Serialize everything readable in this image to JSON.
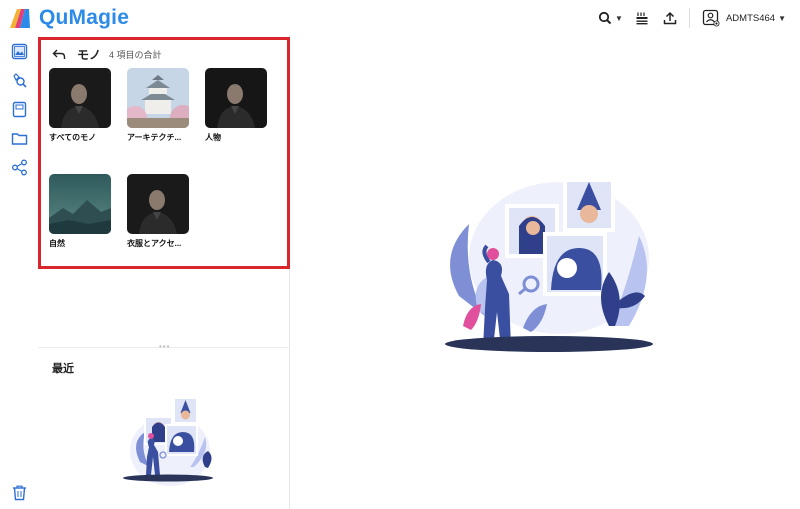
{
  "app": {
    "brand": "QuMagie"
  },
  "header": {
    "user_name": "ADMTS464",
    "icons": [
      "search-icon",
      "stream-icon",
      "upload-icon",
      "user-icon"
    ]
  },
  "rail": {
    "icons": [
      "photos-icon",
      "ai-search-icon",
      "album-icon",
      "folder-icon",
      "share-icon",
      "trash-icon"
    ]
  },
  "things": {
    "title": "モノ",
    "count": "4 項目の合計",
    "items": [
      {
        "label": "すべてのモノ"
      },
      {
        "label": "アーキテクチ..."
      },
      {
        "label": "人物"
      },
      {
        "label": "自然"
      },
      {
        "label": "衣服とアクセ..."
      }
    ]
  },
  "recent": {
    "title": "最近"
  },
  "colors": {
    "brand": "#2c8be8",
    "highlight": "#d9262c",
    "illustration_primary": "#3b4fa0",
    "illustration_accent": "#e0509c"
  }
}
